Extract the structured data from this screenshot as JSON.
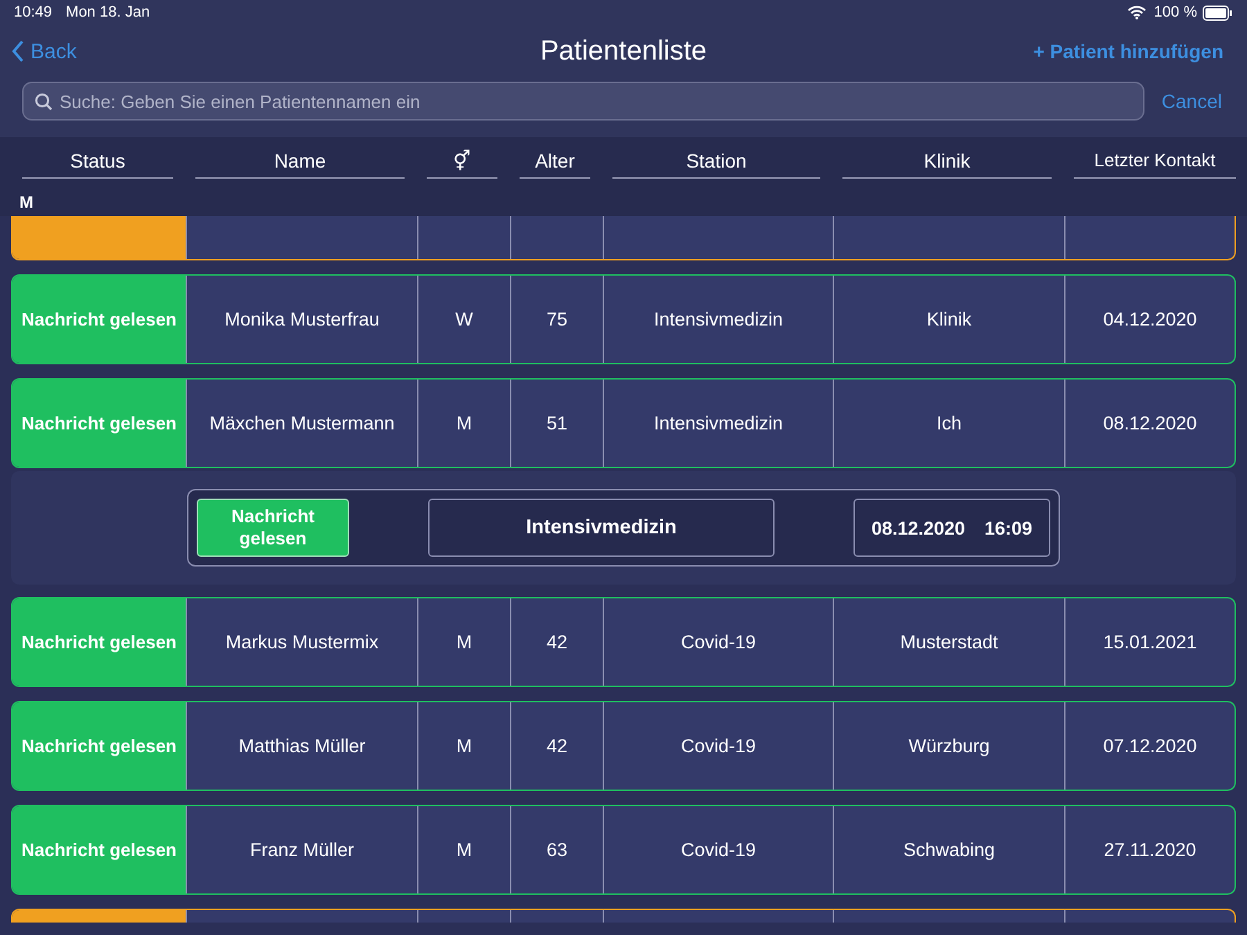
{
  "status_bar": {
    "time": "10:49",
    "date": "Mon 18. Jan",
    "battery": "100 %"
  },
  "nav": {
    "back": "Back",
    "title": "Patientenliste",
    "add": "+ Patient hinzufügen"
  },
  "search": {
    "placeholder": "Suche: Geben Sie einen Patientennamen ein",
    "cancel": "Cancel"
  },
  "table": {
    "columns": [
      "Status",
      "Name",
      "⚥",
      "Alter",
      "Station",
      "Klinik",
      "Letzter Kontakt"
    ],
    "section": "M",
    "rows": [
      {
        "kind": "partial",
        "color": "#f0a020"
      },
      {
        "kind": "patient",
        "color": "#1fbf60",
        "cells": [
          "Nachricht gelesen",
          "Monika Musterfrau",
          "W",
          "75",
          "Intensivmedizin",
          "Klinik",
          "04.12.2020"
        ]
      },
      {
        "kind": "patient",
        "color": "#1fbf60",
        "cells": [
          "Nachricht gelesen",
          "Mäxchen Mustermann",
          "M",
          "51",
          "Intensivmedizin",
          "Ich",
          "08.12.2020"
        ],
        "detail": {
          "status": "Nachricht gelesen",
          "station": "Intensivmedizin",
          "date": "08.12.2020",
          "time": "16:09"
        }
      },
      {
        "kind": "patient",
        "color": "#1fbf60",
        "cells": [
          "Nachricht gelesen",
          "Markus Mustermix",
          "M",
          "42",
          "Covid-19",
          "Musterstadt",
          "15.01.2021"
        ]
      },
      {
        "kind": "patient",
        "color": "#1fbf60",
        "cells": [
          "Nachricht gelesen",
          "Matthias Müller",
          "M",
          "42",
          "Covid-19",
          "Würzburg",
          "07.12.2020"
        ]
      },
      {
        "kind": "patient",
        "color": "#1fbf60",
        "cells": [
          "Nachricht gelesen",
          "Franz Müller",
          "M",
          "63",
          "Covid-19",
          "Schwabing",
          "27.11.2020"
        ]
      },
      {
        "kind": "partial",
        "color": "#f0a020"
      }
    ]
  }
}
